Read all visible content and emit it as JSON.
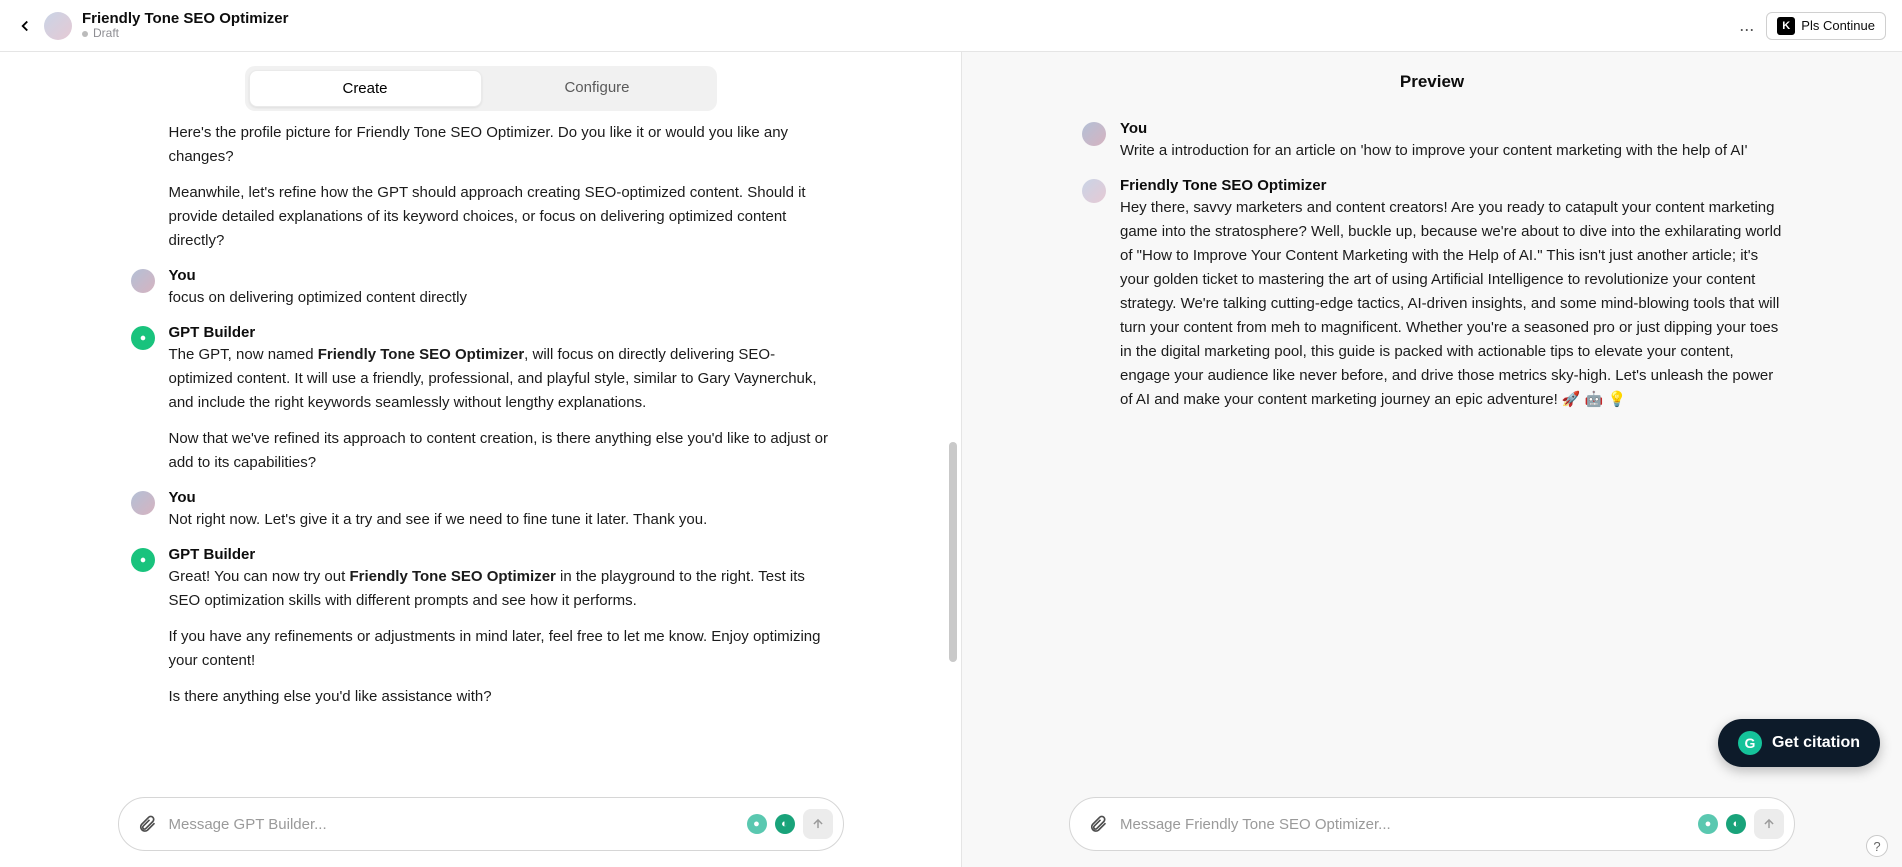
{
  "header": {
    "title": "Friendly Tone SEO Optimizer",
    "subtitle": "Draft",
    "save_button": "Pls Continue",
    "save_badge": "K",
    "more_label": "..."
  },
  "tabs": {
    "create": "Create",
    "configure": "Configure",
    "active": "create"
  },
  "left_chat": {
    "intro_para1_pre": "Here's the profile picture for ",
    "intro_para1_bold": "Friendly Tone SEO Optimizer",
    "intro_para1_post": ". Do you like it or would you like any changes?",
    "intro_para2": "Meanwhile, let's refine how the GPT should approach creating SEO-optimized content. Should it provide detailed explanations of its keyword choices, or focus on delivering optimized content directly?",
    "m1": {
      "name": "You",
      "text": "focus on delivering optimized content directly"
    },
    "m2": {
      "name": "GPT Builder",
      "p1_pre": "The GPT, now named ",
      "p1_bold": "Friendly Tone SEO Optimizer",
      "p1_post": ", will focus on directly delivering SEO-optimized content. It will use a friendly, professional, and playful style, similar to Gary Vaynerchuk, and include the right keywords seamlessly without lengthy explanations.",
      "p2": "Now that we've refined its approach to content creation, is there anything else you'd like to adjust or add to its capabilities?"
    },
    "m3": {
      "name": "You",
      "text": "Not right now. Let's give it a try and see if we need to fine tune it later. Thank you."
    },
    "m4": {
      "name": "GPT Builder",
      "p1_pre": "Great! You can now try out ",
      "p1_bold": "Friendly Tone SEO Optimizer",
      "p1_post": " in the playground to the right. Test its SEO optimization skills with different prompts and see how it performs.",
      "p2": "If you have any refinements or adjustments in mind later, feel free to let me know. Enjoy optimizing your content!",
      "p3": "Is there anything else you'd like assistance with?"
    }
  },
  "left_composer": {
    "placeholder": "Message GPT Builder..."
  },
  "preview": {
    "title": "Preview",
    "m1": {
      "name": "You",
      "text": "Write a introduction for an article on 'how to improve your content marketing with the help of AI'"
    },
    "m2": {
      "name": "Friendly Tone SEO Optimizer",
      "text": "Hey there, savvy marketers and content creators! Are you ready to catapult your content marketing game into the stratosphere? Well, buckle up, because we're about to dive into the exhilarating world of \"How to Improve Your Content Marketing with the Help of AI.\" This isn't just another article; it's your golden ticket to mastering the art of using Artificial Intelligence to revolutionize your content strategy. We're talking cutting-edge tactics, AI-driven insights, and some mind-blowing tools that will turn your content from meh to magnificent. Whether you're a seasoned pro or just dipping your toes in the digital marketing pool, this guide is packed with actionable tips to elevate your content, engage your audience like never before, and drive those metrics sky-high. Let's unleash the power of AI and make your content marketing journey an epic adventure! 🚀 🤖 💡"
    }
  },
  "right_composer": {
    "placeholder": "Message Friendly Tone SEO Optimizer..."
  },
  "citation_button": "Get citation",
  "citation_badge": "G",
  "help_label": "?"
}
